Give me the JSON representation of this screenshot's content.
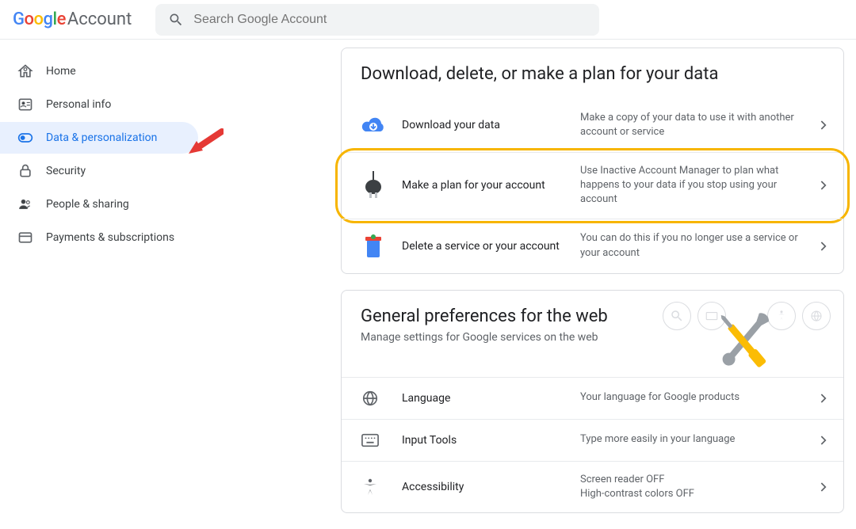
{
  "header": {
    "logo_prefix": "Google",
    "logo_suffix": "Account",
    "search_placeholder": "Search Google Account"
  },
  "sidebar": {
    "items": [
      {
        "label": "Home"
      },
      {
        "label": "Personal info"
      },
      {
        "label": "Data & personalization"
      },
      {
        "label": "Security"
      },
      {
        "label": "People & sharing"
      },
      {
        "label": "Payments & subscriptions"
      }
    ]
  },
  "cards": {
    "data_plan": {
      "title": "Download, delete, or make a plan for your data",
      "rows": [
        {
          "label": "Download your data",
          "desc": "Make a copy of your data to use it with another account or service"
        },
        {
          "label": "Make a plan for your account",
          "desc": "Use Inactive Account Manager to plan what happens to your data if you stop using your account"
        },
        {
          "label": "Delete a service or your account",
          "desc": "You can do this if you no longer use a service or your account"
        }
      ]
    },
    "preferences": {
      "title": "General preferences for the web",
      "subtitle": "Manage settings for Google services on the web",
      "rows": [
        {
          "label": "Language",
          "desc": "Your language for Google products"
        },
        {
          "label": "Input Tools",
          "desc": "Type more easily in your language"
        },
        {
          "label": "Accessibility",
          "desc": "Screen reader OFF\nHigh-contrast colors OFF"
        }
      ]
    }
  }
}
